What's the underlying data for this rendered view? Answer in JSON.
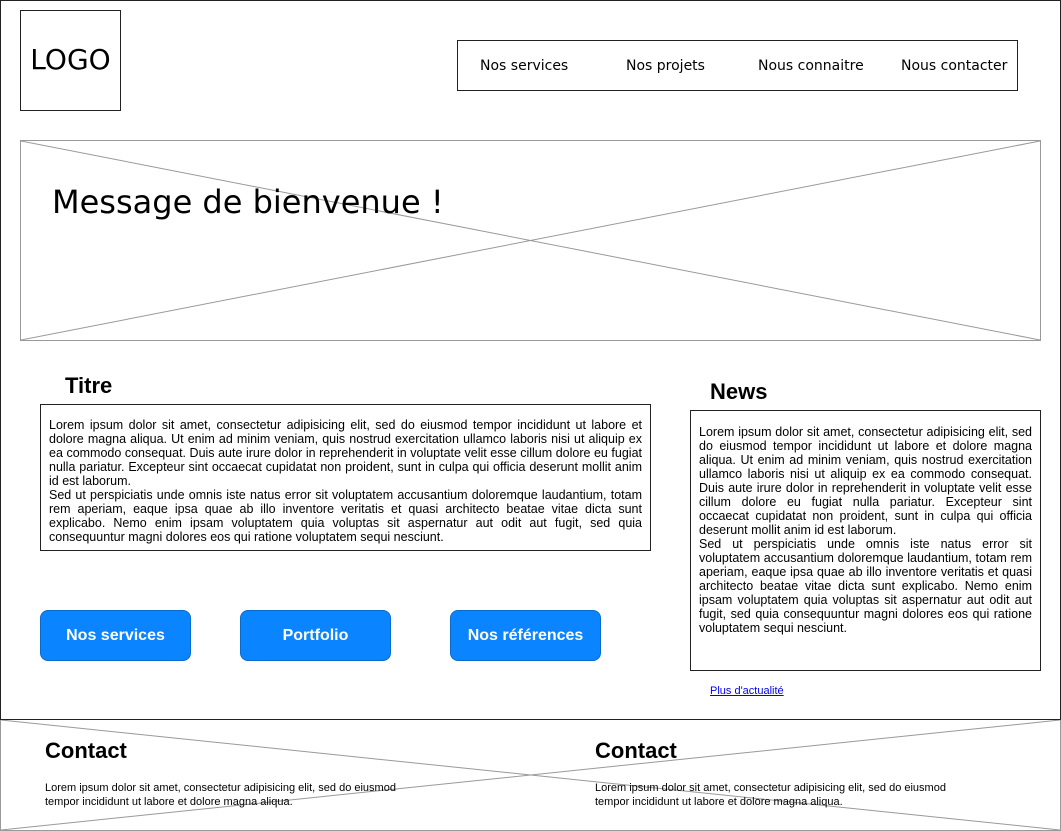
{
  "header": {
    "logo": "LOGO",
    "nav": [
      "Nos services",
      "Nos projets",
      "Nous connaitre",
      "Nous contacter"
    ]
  },
  "hero": {
    "message": "Message de bienvenue !"
  },
  "main": {
    "title": "Titre",
    "paragraph1": "Lorem ipsum dolor sit amet, consectetur adipisicing elit, sed do eiusmod tempor incididunt ut labore et dolore magna aliqua. Ut enim ad minim veniam, quis nostrud exercitation ullamco laboris nisi ut aliquip ex ea commodo consequat. Duis aute irure dolor in reprehenderit in voluptate velit esse cillum dolore eu fugiat nulla pariatur. Excepteur sint occaecat cupidatat non proident, sunt in culpa qui officia deserunt mollit anim id est laborum.",
    "paragraph2": "Sed ut perspiciatis unde omnis iste natus error sit voluptatem accusantium doloremque laudantium, totam rem aperiam, eaque ipsa quae ab illo inventore veritatis et quasi architecto beatae vitae dicta sunt explicabo. Nemo enim ipsam voluptatem quia voluptas sit aspernatur aut odit aut fugit, sed quia consequuntur magni dolores eos qui ratione voluptatem sequi nesciunt.",
    "buttons": [
      "Nos services",
      "Portfolio",
      "Nos références"
    ]
  },
  "news": {
    "title": "News",
    "paragraph1": "Lorem ipsum dolor sit amet, consectetur adipisicing elit, sed do eiusmod tempor incididunt ut labore et dolore magna aliqua. Ut enim ad minim veniam, quis nostrud exercitation ullamco laboris nisi ut aliquip ex ea commodo consequat. Duis aute irure dolor in reprehenderit in voluptate velit esse cillum dolore eu fugiat nulla pariatur. Excepteur sint occaecat cupidatat non proident, sunt in culpa qui officia deserunt mollit anim id est laborum.",
    "paragraph2": "Sed ut perspiciatis unde omnis iste natus error sit voluptatem accusantium doloremque laudantium, totam rem aperiam, eaque ipsa quae ab illo inventore veritatis et quasi architecto beatae vitae dicta sunt explicabo. Nemo enim ipsam voluptatem quia voluptas sit aspernatur aut odit aut fugit, sed quia consequuntur magni dolores eos qui ratione voluptatem sequi nesciunt.",
    "more_link": "Plus d'actualité"
  },
  "footer": {
    "contacts": [
      {
        "title": "Contact",
        "text": "Lorem ipsum dolor sit amet, consectetur adipisicing elit, sed do eiusmod tempor incididunt ut labore et dolore magna aliqua."
      },
      {
        "title": "Contact",
        "text": "Lorem ipsum dolor sit amet, consectetur adipisicing elit, sed do eiusmod tempor incididunt ut labore et dolore magna aliqua."
      }
    ]
  },
  "colors": {
    "button": "#0b84ff",
    "link": "#0000ee",
    "placeholder_lines": "#999999"
  }
}
